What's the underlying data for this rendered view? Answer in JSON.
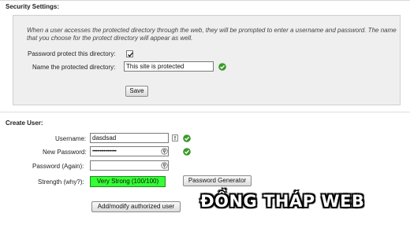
{
  "security": {
    "title": "Security Settings:",
    "description": "When a user accesses the protected directory through the web, they will be prompted to enter a username and password. The name that you choose for the protect directory will appear as well.",
    "protect_label": "Password protect this directory:",
    "protect_checked": true,
    "name_label": "Name the protected directory:",
    "name_value": "This site is protected",
    "save_label": "Save"
  },
  "create_user": {
    "title": "Create User:",
    "username_label": "Username:",
    "username_value": "dasdsad",
    "new_password_label": "New Password:",
    "new_password_value": "•••••••••••••••••••",
    "password_again_label": "Password (Again):",
    "password_again_value": "",
    "strength_label": "Strength",
    "strength_why": "(why?):",
    "strength_value": "Very Strong (100/100)",
    "password_generator_label": "Password Generator",
    "add_modify_label": "Add/modify authorized user"
  },
  "watermark": "ĐỒNG THÁP WEB",
  "colors": {
    "valid_check": "#3a9a2a",
    "strength_bar": "#33ff33",
    "panel_bg": "#efefef"
  }
}
